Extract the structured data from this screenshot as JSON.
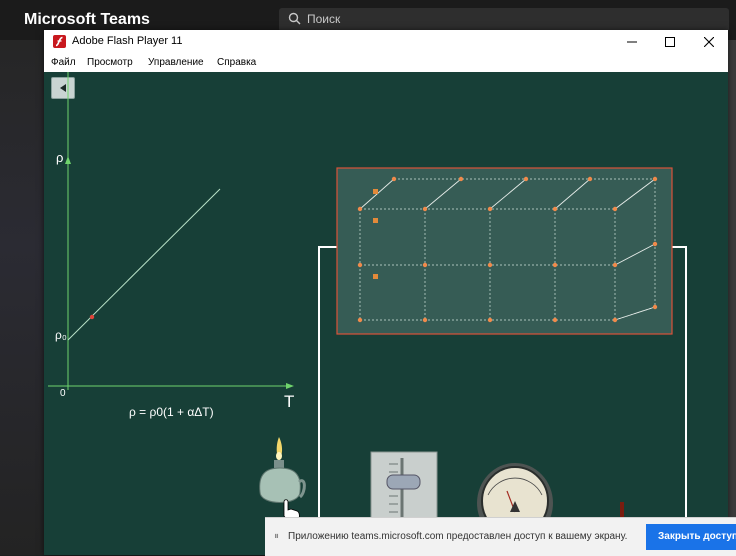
{
  "teams": {
    "title": "Microsoft Teams",
    "search_placeholder": "Поиск"
  },
  "flash": {
    "title": "Adobe Flash Player 11",
    "menu": [
      "Файл",
      "Просмотр",
      "Управление",
      "Справка"
    ]
  },
  "simulation": {
    "y_axis_label": "ρ",
    "y_intercept_label": "ρ₀",
    "x_axis_label": "T",
    "origin_label": "0",
    "formula": "ρ = ρ0(1 + αΔT)"
  },
  "notification": {
    "pause_glyph": "⏸",
    "text": "Приложению teams.microsoft.com предоставлен доступ к вашему экрану.",
    "close_button": "Закрыть доступ"
  },
  "colors": {
    "stage_bg": "#173f37",
    "lattice_bg": "#365c55",
    "lattice_border": "#d9533a",
    "accent_blue": "#1a73e8"
  }
}
